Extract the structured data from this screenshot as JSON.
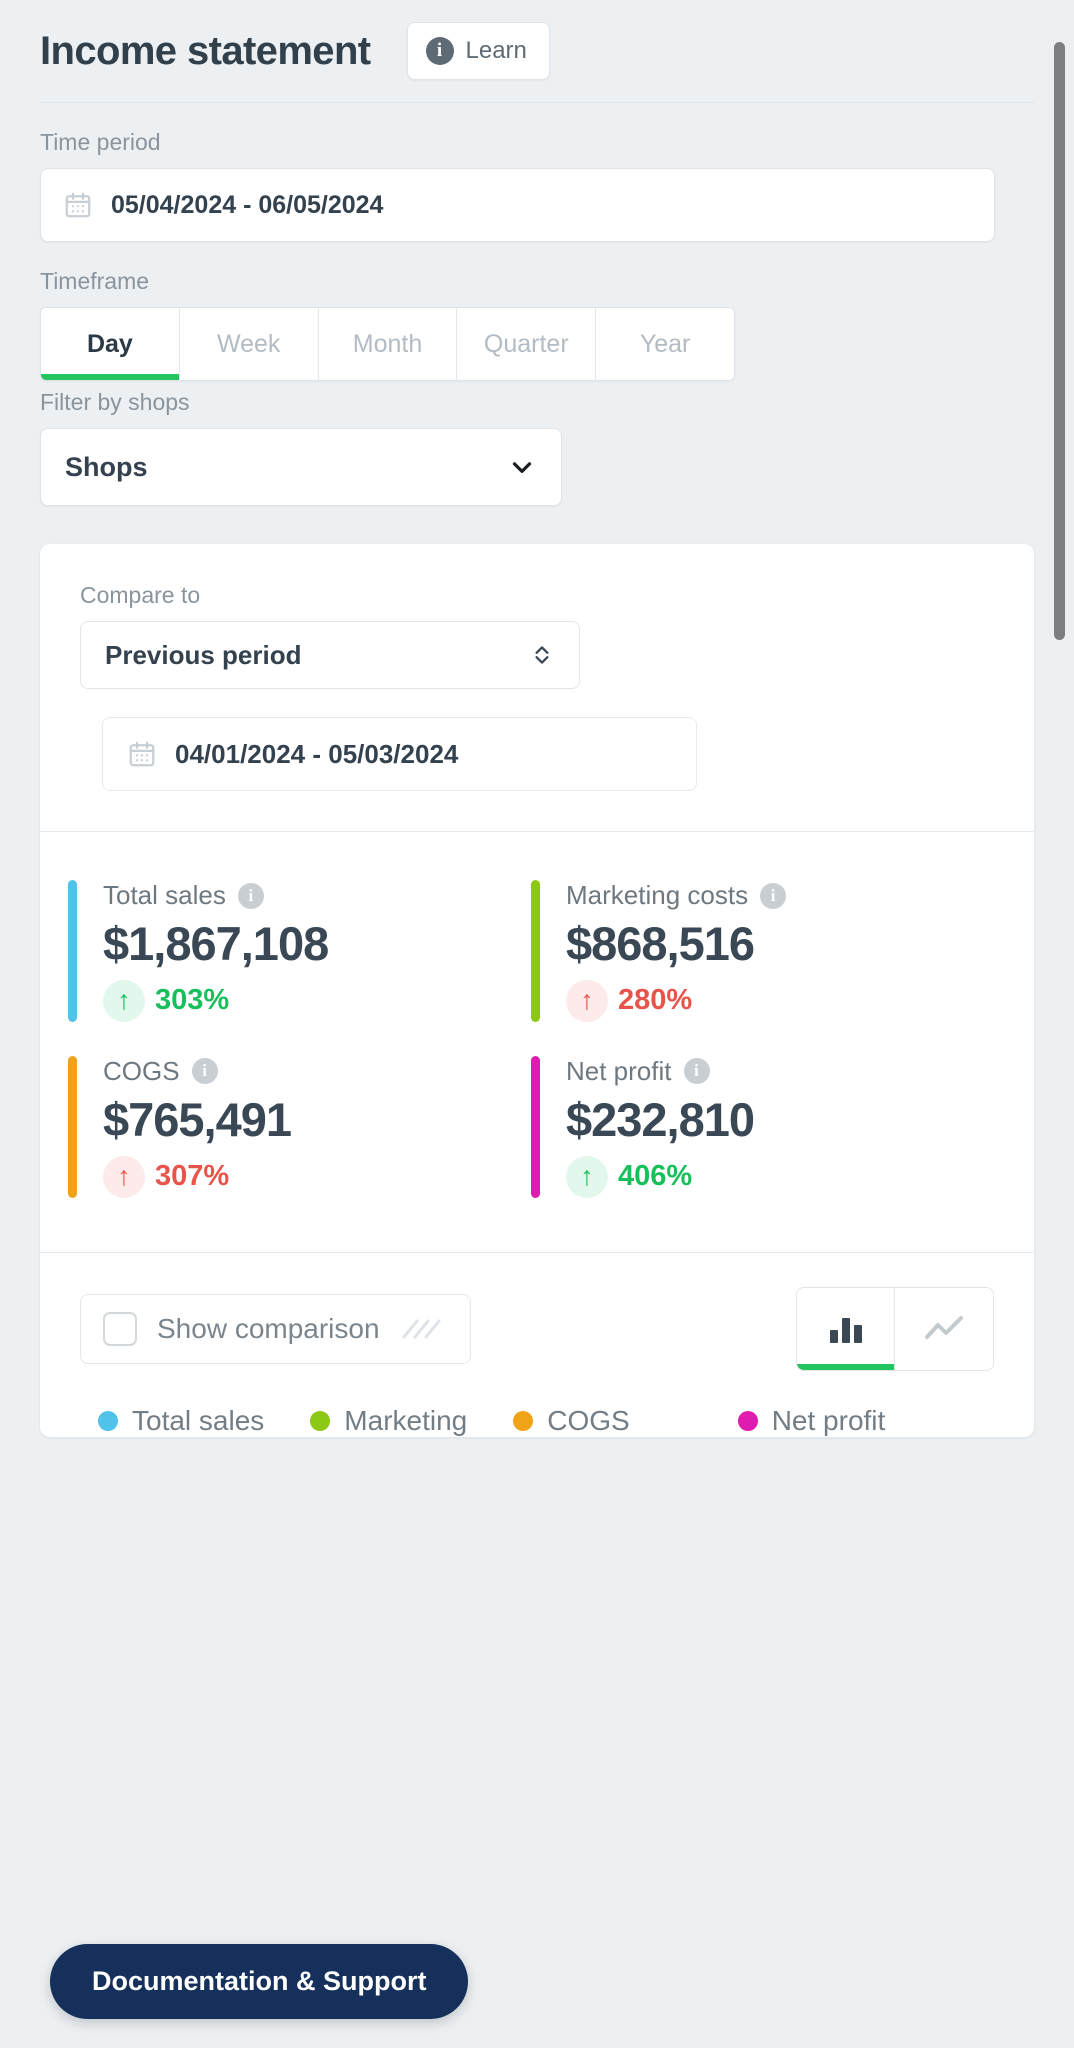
{
  "header": {
    "title": "Income statement",
    "learn_label": "Learn",
    "learn_icon": "info-icon"
  },
  "filters": {
    "time_period_label": "Time period",
    "time_period_value": "05/04/2024 - 06/05/2024",
    "time_period_icon": "calendar-icon",
    "timeframe_label": "Timeframe",
    "timeframe_options": [
      "Day",
      "Week",
      "Month",
      "Quarter",
      "Year"
    ],
    "timeframe_active": "Day",
    "shops_label": "Filter by shops",
    "shops_value": "Shops",
    "shops_icon": "chevron-down-icon"
  },
  "compare": {
    "label": "Compare to",
    "value": "Previous period",
    "select_icon": "chevron-updown-icon",
    "date_value": "04/01/2024 - 05/03/2024",
    "date_icon": "calendar-icon"
  },
  "metrics": [
    {
      "name": "Total sales",
      "value": "$1,867,108",
      "delta": "303%",
      "direction": "up",
      "tone": "good",
      "accent": "#4fc3ea",
      "info_icon": "info-icon",
      "arrow_icon": "arrow-up-icon"
    },
    {
      "name": "Marketing costs",
      "value": "$868,516",
      "delta": "280%",
      "direction": "up",
      "tone": "bad",
      "accent": "#8cc914",
      "info_icon": "info-icon",
      "arrow_icon": "arrow-up-icon"
    },
    {
      "name": "COGS",
      "value": "$765,491",
      "delta": "307%",
      "direction": "up",
      "tone": "bad",
      "accent": "#f0a318",
      "info_icon": "info-icon",
      "arrow_icon": "arrow-up-icon"
    },
    {
      "name": "Net profit",
      "value": "$232,810",
      "delta": "406%",
      "direction": "up",
      "tone": "good",
      "accent": "#e01cb0",
      "info_icon": "info-icon",
      "arrow_icon": "arrow-up-icon"
    }
  ],
  "chart_controls": {
    "show_comparison_label": "Show comparison",
    "show_comparison_checked": false,
    "checkbox_icon": "checkbox-unchecked-icon",
    "hatch_icon": "hatch-pattern-icon",
    "types": [
      {
        "id": "bar",
        "icon": "bar-chart-icon",
        "active": true
      },
      {
        "id": "line",
        "icon": "line-chart-icon",
        "active": false
      }
    ]
  },
  "legend": [
    {
      "label": "Total sales",
      "color": "#4fc3ea"
    },
    {
      "label": "Marketing",
      "color": "#8cc914"
    },
    {
      "label": "COGS",
      "color": "#f0a318"
    },
    {
      "label": "Net profit",
      "color": "#e01cb0"
    }
  ],
  "docs": {
    "label": "Documentation & Support"
  },
  "colors": {
    "accent_green": "#22c55e",
    "page_bg": "#edf0f2",
    "text_dark": "#33424e",
    "text_muted": "#8a949d",
    "positive": "#18bf5b",
    "negative": "#e8544a",
    "docs_bg": "#16305c"
  }
}
